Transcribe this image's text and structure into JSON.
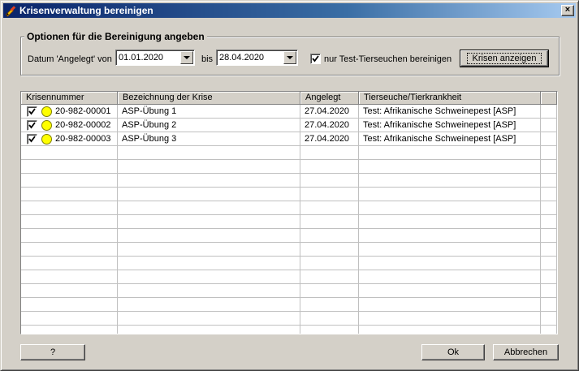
{
  "window": {
    "title": "Krisenverwaltung bereinigen",
    "close_label": "×"
  },
  "options": {
    "legend": "Optionen für die Bereinigung angeben",
    "from_label": "Datum 'Angelegt' von",
    "from_value": "01.01.2020",
    "to_label": "bis",
    "to_value": "28.04.2020",
    "test_only_checked": true,
    "test_only_label": "nur Test-Tierseuchen bereinigen",
    "show_button": "Krisen anzeigen"
  },
  "table": {
    "columns": [
      "Krisennummer",
      "Bezeichnung der Krise",
      "Angelegt",
      "Tierseuche/Tierkrankheit"
    ],
    "rows": [
      {
        "checked": true,
        "status_color": "#ffff00",
        "krisennummer": "20-982-00001",
        "bezeichnung": "ASP-Übung 1",
        "angelegt": "27.04.2020",
        "tierseuche": "Test: Afrikanische Schweinepest [ASP]"
      },
      {
        "checked": true,
        "status_color": "#ffff00",
        "krisennummer": "20-982-00002",
        "bezeichnung": "ASP-Übung 2",
        "angelegt": "27.04.2020",
        "tierseuche": "Test: Afrikanische Schweinepest [ASP]"
      },
      {
        "checked": true,
        "status_color": "#ffff00",
        "krisennummer": "20-982-00003",
        "bezeichnung": "ASP-Übung 3",
        "angelegt": "27.04.2020",
        "tierseuche": "Test: Afrikanische Schweinepest [ASP]"
      }
    ]
  },
  "footer": {
    "help_label": "?",
    "ok_label": "Ok",
    "cancel_label": "Abbrechen"
  },
  "colors": {
    "titlebar_start": "#0a246a",
    "titlebar_end": "#a6caf0",
    "face": "#d4d0c8",
    "status_yellow": "#ffff00"
  }
}
